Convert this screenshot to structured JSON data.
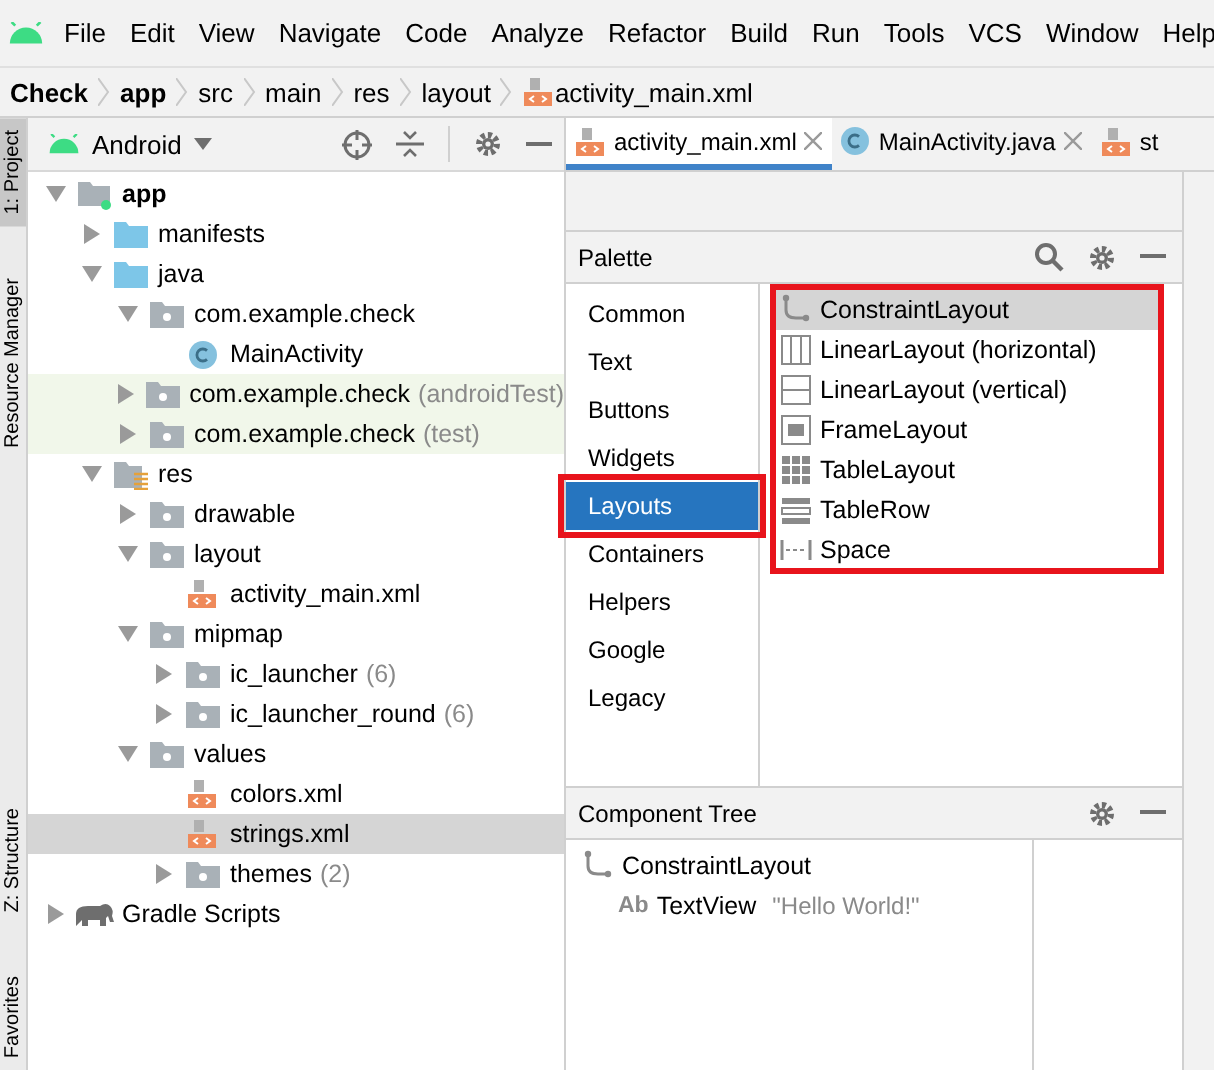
{
  "menu": [
    "File",
    "Edit",
    "View",
    "Navigate",
    "Code",
    "Analyze",
    "Refactor",
    "Build",
    "Run",
    "Tools",
    "VCS",
    "Window",
    "Help"
  ],
  "breadcrumb": [
    {
      "label": "Check",
      "bold": true,
      "kind": "text"
    },
    {
      "label": "app",
      "bold": true,
      "kind": "text"
    },
    {
      "label": "src",
      "bold": false,
      "kind": "text"
    },
    {
      "label": "main",
      "bold": false,
      "kind": "text"
    },
    {
      "label": "res",
      "bold": false,
      "kind": "text"
    },
    {
      "label": "layout",
      "bold": false,
      "kind": "text"
    },
    {
      "label": "activity_main.xml",
      "bold": false,
      "kind": "xml"
    }
  ],
  "side_tabs": [
    {
      "label": "1: Project",
      "selected": true
    },
    {
      "label": "Resource Manager",
      "selected": false
    },
    {
      "label": "Z: Structure",
      "selected": false
    },
    {
      "label": "Favorites",
      "selected": false
    }
  ],
  "project": {
    "view": "Android",
    "tree": [
      {
        "label": "app",
        "kind": "module",
        "expanded": true,
        "selected": false,
        "children": [
          {
            "label": "manifests",
            "kind": "folder",
            "expanded": false,
            "selected": false
          },
          {
            "label": "java",
            "kind": "folder",
            "expanded": true,
            "selected": false,
            "children": [
              {
                "label": "com.example.check",
                "kind": "package",
                "expanded": true,
                "selected": false,
                "children": [
                  {
                    "label": "MainActivity",
                    "kind": "class",
                    "selected": false
                  }
                ]
              },
              {
                "label": "com.example.check",
                "suffix": "(androidTest)",
                "kind": "test-package",
                "expanded": false,
                "selected": false
              },
              {
                "label": "com.example.check",
                "suffix": "(test)",
                "kind": "test-package",
                "expanded": false,
                "selected": false
              }
            ]
          },
          {
            "label": "res",
            "kind": "res",
            "expanded": true,
            "selected": false,
            "children": [
              {
                "label": "drawable",
                "kind": "package",
                "expanded": false,
                "selected": false
              },
              {
                "label": "layout",
                "kind": "package",
                "expanded": true,
                "selected": false,
                "children": [
                  {
                    "label": "activity_main.xml",
                    "kind": "xml",
                    "selected": false
                  }
                ]
              },
              {
                "label": "mipmap",
                "kind": "package",
                "expanded": true,
                "selected": false,
                "children": [
                  {
                    "label": "ic_launcher",
                    "suffix": "(6)",
                    "kind": "package",
                    "expanded": false,
                    "selected": false
                  },
                  {
                    "label": "ic_launcher_round",
                    "suffix": "(6)",
                    "kind": "package",
                    "expanded": false,
                    "selected": false
                  }
                ]
              },
              {
                "label": "values",
                "kind": "package",
                "expanded": true,
                "selected": false,
                "children": [
                  {
                    "label": "colors.xml",
                    "kind": "xml",
                    "selected": false
                  },
                  {
                    "label": "strings.xml",
                    "kind": "xml",
                    "selected": true
                  },
                  {
                    "label": "themes",
                    "suffix": "(2)",
                    "kind": "package",
                    "expanded": false,
                    "selected": false
                  }
                ]
              }
            ]
          }
        ]
      },
      {
        "label": "Gradle Scripts",
        "kind": "gradle",
        "expanded": false,
        "selected": false
      }
    ]
  },
  "editor_tabs": [
    {
      "label": "activity_main.xml",
      "kind": "xml",
      "selected": true,
      "closable": true
    },
    {
      "label": "MainActivity.java",
      "kind": "class",
      "selected": false,
      "closable": true
    },
    {
      "label": "st",
      "kind": "xml",
      "selected": false,
      "closable": false
    }
  ],
  "palette": {
    "title": "Palette",
    "annotated": true,
    "categories": [
      {
        "label": "Common",
        "selected": false,
        "annotated": false
      },
      {
        "label": "Text",
        "selected": false,
        "annotated": false
      },
      {
        "label": "Buttons",
        "selected": false,
        "annotated": false
      },
      {
        "label": "Widgets",
        "selected": false,
        "annotated": false
      },
      {
        "label": "Layouts",
        "selected": true,
        "annotated": true
      },
      {
        "label": "Containers",
        "selected": false,
        "annotated": false
      },
      {
        "label": "Helpers",
        "selected": false,
        "annotated": false
      },
      {
        "label": "Google",
        "selected": false,
        "annotated": false
      },
      {
        "label": "Legacy",
        "selected": false,
        "annotated": false
      }
    ],
    "items": [
      {
        "label": "ConstraintLayout",
        "kind": "constraint",
        "selected": true
      },
      {
        "label": "LinearLayout (horizontal)",
        "kind": "columns",
        "selected": false
      },
      {
        "label": "LinearLayout (vertical)",
        "kind": "rows",
        "selected": false
      },
      {
        "label": "FrameLayout",
        "kind": "frame",
        "selected": false
      },
      {
        "label": "TableLayout",
        "kind": "table",
        "selected": false
      },
      {
        "label": "TableRow",
        "kind": "tablerow",
        "selected": false
      },
      {
        "label": "Space",
        "kind": "space",
        "selected": false
      }
    ]
  },
  "component_tree": {
    "title": "Component Tree",
    "items": [
      {
        "label": "ConstraintLayout",
        "kind": "constraint",
        "children": [
          {
            "label": "TextView",
            "kind": "textview",
            "badge": "Ab",
            "value": "\"Hello World!\""
          }
        ]
      }
    ]
  }
}
